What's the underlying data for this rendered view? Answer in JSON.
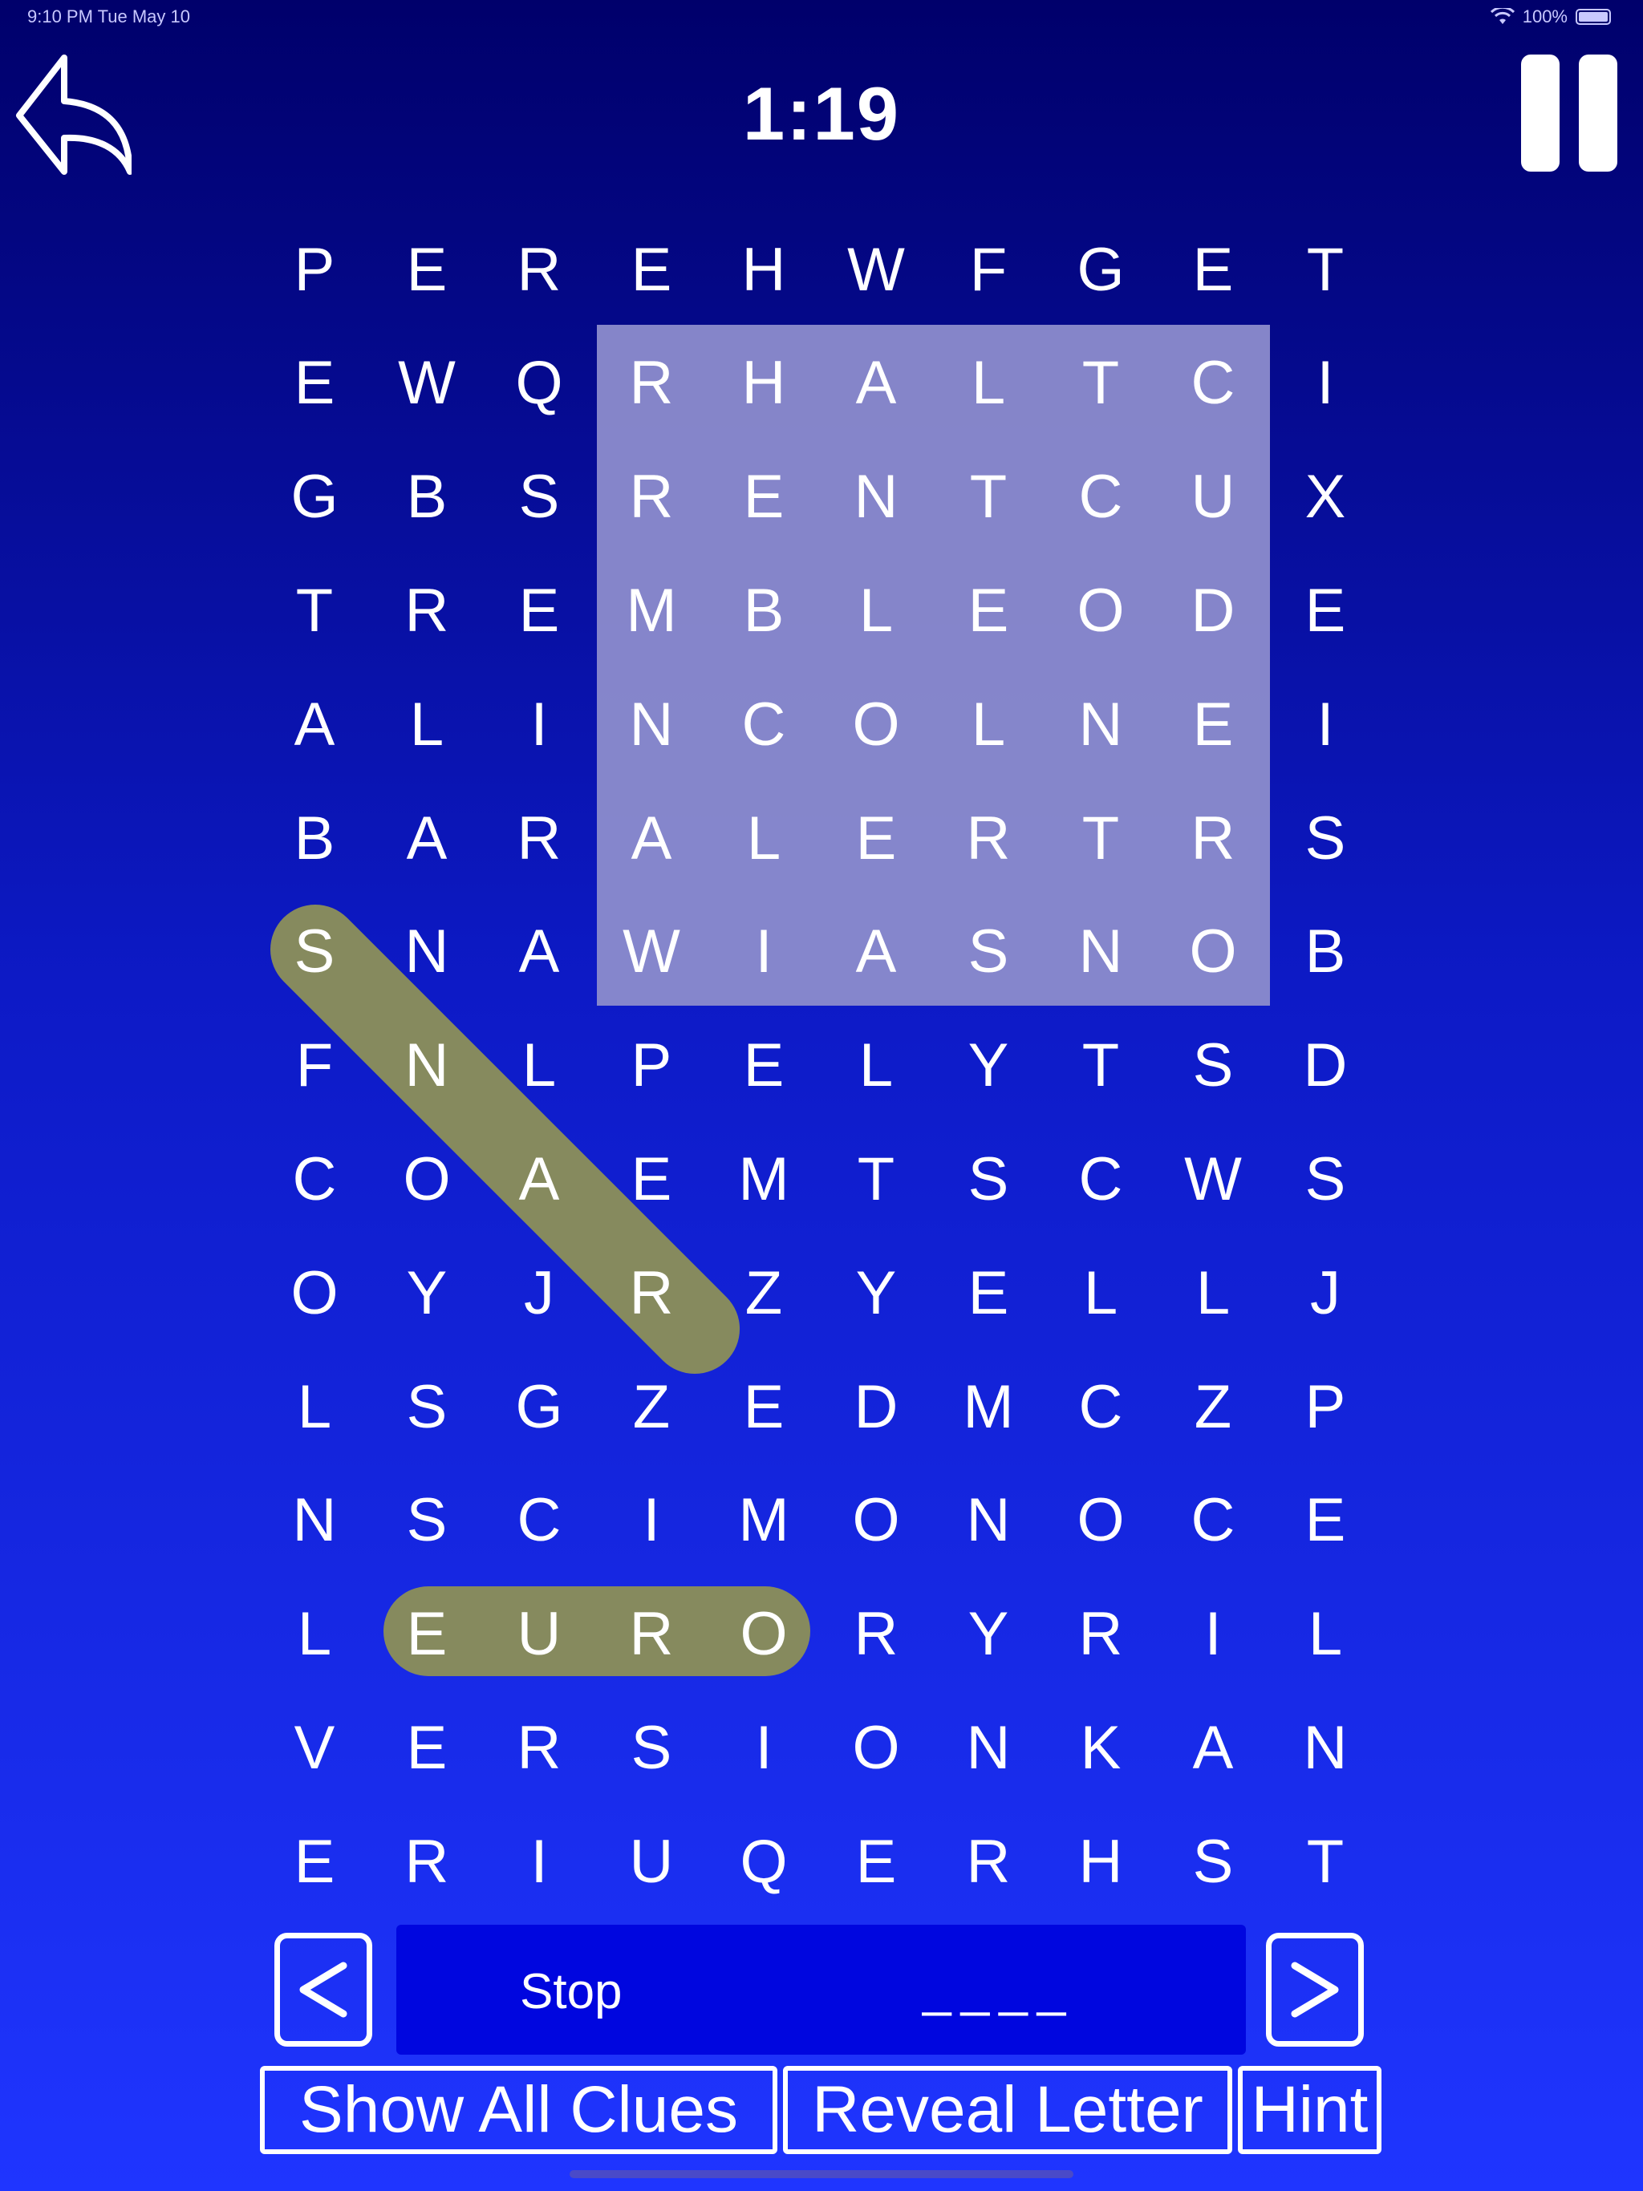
{
  "status_bar": {
    "time_date": "9:10 PM  Tue May 10",
    "battery": "100%"
  },
  "header": {
    "timer": "1:19"
  },
  "grid": {
    "rows": [
      [
        "P",
        "E",
        "R",
        "E",
        "H",
        "W",
        "F",
        "G",
        "E",
        "T"
      ],
      [
        "E",
        "W",
        "Q",
        "R",
        "H",
        "A",
        "L",
        "T",
        "C",
        "I"
      ],
      [
        "G",
        "B",
        "S",
        "R",
        "E",
        "N",
        "T",
        "C",
        "U",
        "X"
      ],
      [
        "T",
        "R",
        "E",
        "M",
        "B",
        "L",
        "E",
        "O",
        "D",
        "E"
      ],
      [
        "A",
        "L",
        "I",
        "N",
        "C",
        "O",
        "L",
        "N",
        "E",
        "I"
      ],
      [
        "B",
        "A",
        "R",
        "A",
        "L",
        "E",
        "R",
        "T",
        "R",
        "S"
      ],
      [
        "S",
        "N",
        "A",
        "W",
        "I",
        "A",
        "S",
        "N",
        "O",
        "B"
      ],
      [
        "F",
        "N",
        "L",
        "P",
        "E",
        "L",
        "Y",
        "T",
        "S",
        "D"
      ],
      [
        "C",
        "O",
        "A",
        "E",
        "M",
        "T",
        "S",
        "C",
        "W",
        "S"
      ],
      [
        "O",
        "Y",
        "J",
        "R",
        "Z",
        "Y",
        "E",
        "L",
        "L",
        "J"
      ],
      [
        "L",
        "S",
        "G",
        "Z",
        "E",
        "D",
        "M",
        "C",
        "Z",
        "P"
      ],
      [
        "N",
        "S",
        "C",
        "I",
        "M",
        "O",
        "N",
        "O",
        "C",
        "E"
      ],
      [
        "L",
        "E",
        "U",
        "R",
        "O",
        "R",
        "Y",
        "R",
        "I",
        "L"
      ],
      [
        "V",
        "E",
        "R",
        "S",
        "I",
        "O",
        "N",
        "K",
        "A",
        "N"
      ],
      [
        "E",
        "R",
        "I",
        "U",
        "Q",
        "E",
        "R",
        "H",
        "S",
        "T"
      ]
    ]
  },
  "clue": {
    "text": "Stop",
    "blanks": "____"
  },
  "buttons": {
    "prev": "<",
    "next": ">",
    "show_all_clues": "Show All Clues",
    "reveal_letter": "Reveal Letter",
    "hint": "Hint"
  },
  "colors": {
    "found_word": "#868a5e",
    "hint_region": "#8c8ccc",
    "clue_bar": "#0006df"
  }
}
